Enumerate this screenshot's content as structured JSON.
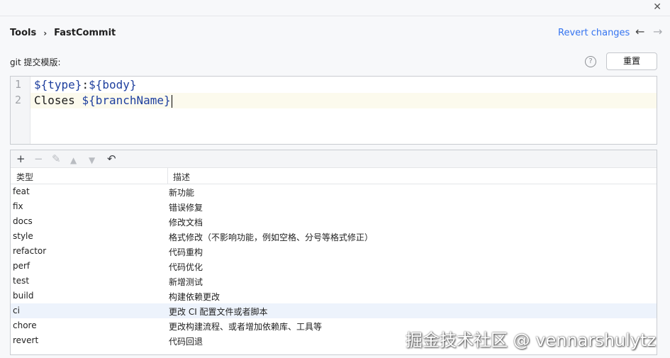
{
  "window": {
    "close_icon": "close-icon"
  },
  "breadcrumb": {
    "root": "Tools",
    "current": "FastCommit"
  },
  "header": {
    "revert_label": "Revert changes"
  },
  "template": {
    "label": "git 提交模版:",
    "reset_label": "重置",
    "help_glyph": "?",
    "lines": [
      {
        "number": "1",
        "text": "${type}:${body}"
      },
      {
        "number": "2",
        "text": "Closes ${branchName}"
      }
    ]
  },
  "table": {
    "columns": [
      "类型",
      "描述"
    ],
    "rows": [
      {
        "type": "feat",
        "desc": "新功能"
      },
      {
        "type": "fix",
        "desc": "错误修复"
      },
      {
        "type": "docs",
        "desc": "修改文档"
      },
      {
        "type": "style",
        "desc": "格式修改（不影响功能，例如空格、分号等格式修正）"
      },
      {
        "type": "refactor",
        "desc": "代码重构"
      },
      {
        "type": "perf",
        "desc": "代码优化"
      },
      {
        "type": "test",
        "desc": "新增测试"
      },
      {
        "type": "build",
        "desc": "构建依赖更改"
      },
      {
        "type": "ci",
        "desc": "更改 CI 配置文件或者脚本"
      },
      {
        "type": "chore",
        "desc": "更改构建流程、或者增加依赖库、工具等"
      },
      {
        "type": "revert",
        "desc": "代码回退"
      }
    ],
    "selected_row": "ci"
  },
  "watermark": "掘金技术社区 @ vennarshulytz"
}
